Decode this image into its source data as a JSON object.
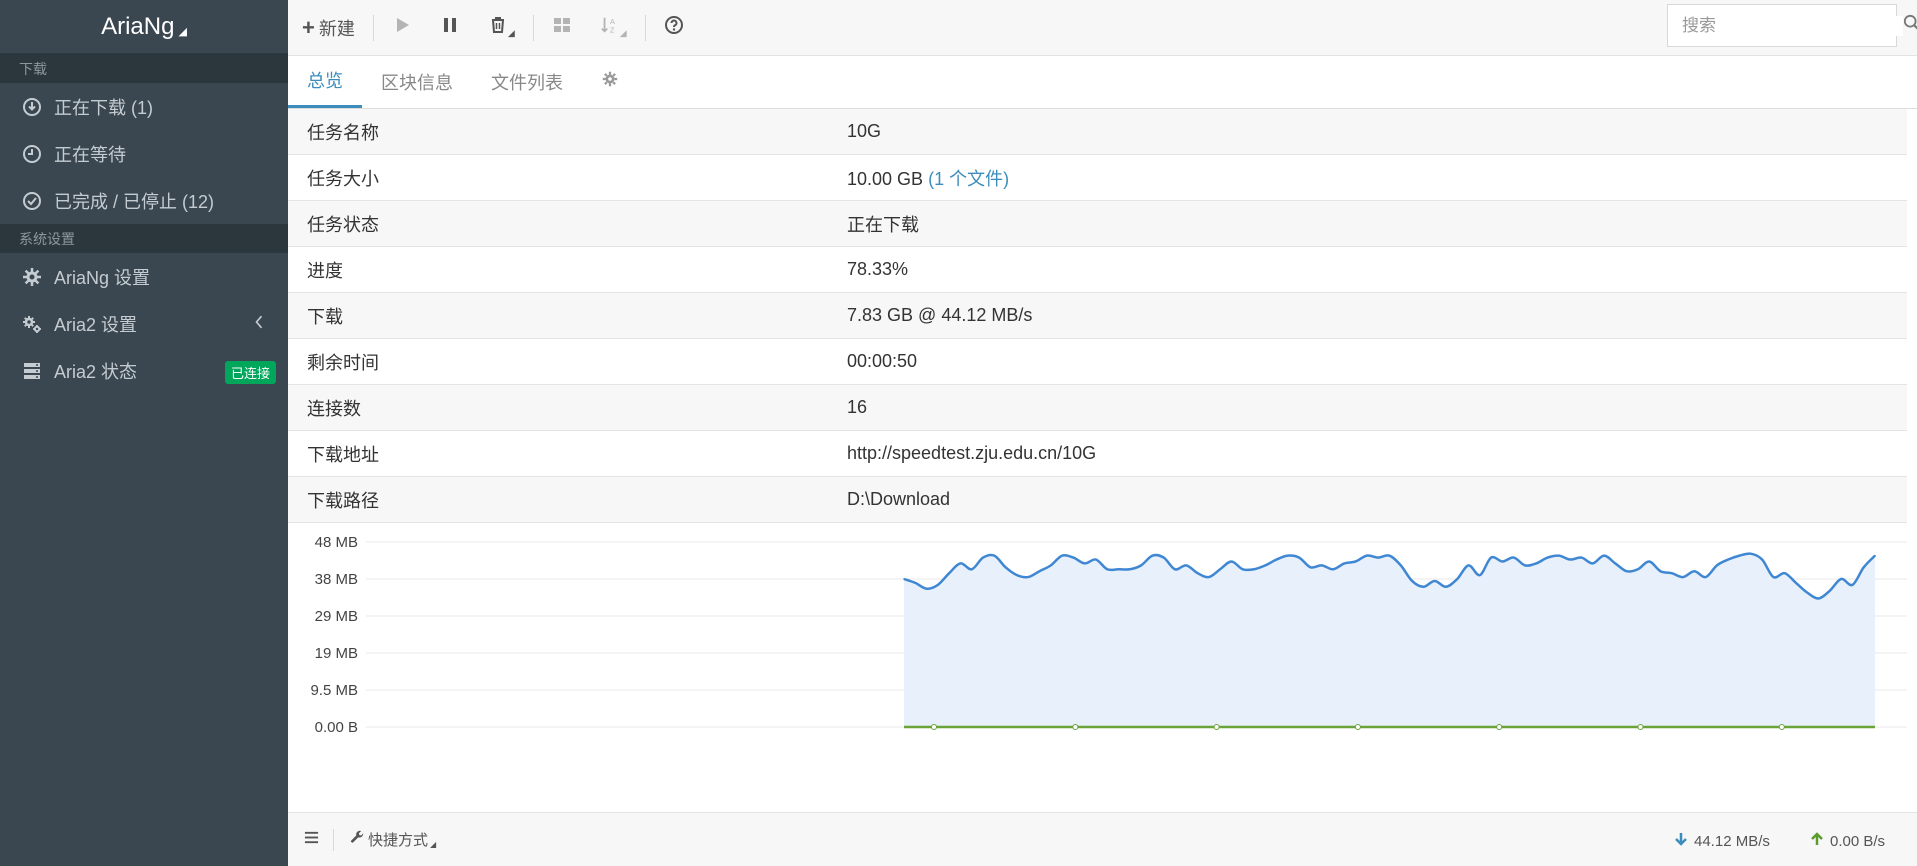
{
  "sidebar": {
    "brand": "AriaNg",
    "download_section": "下载",
    "items": [
      {
        "label": "正在下载 (1)"
      },
      {
        "label": "正在等待"
      },
      {
        "label": "已完成 / 已停止 (12)"
      }
    ],
    "settings_section": "系统设置",
    "settings_items": [
      {
        "label": "AriaNg 设置"
      },
      {
        "label": "Aria2 设置"
      },
      {
        "label": "Aria2 状态",
        "badge": "已连接"
      }
    ]
  },
  "toolbar": {
    "new_label": "新建",
    "search_placeholder": "搜索"
  },
  "tabs": [
    {
      "label": "总览",
      "active": true
    },
    {
      "label": "区块信息"
    },
    {
      "label": "文件列表"
    }
  ],
  "info": [
    {
      "key": "任务名称",
      "value": "10G"
    },
    {
      "key": "任务大小",
      "value": "10.00 GB",
      "link": "(1 个文件)"
    },
    {
      "key": "任务状态",
      "value": "正在下载"
    },
    {
      "key": "进度",
      "value": "78.33%"
    },
    {
      "key": "下载",
      "value": "7.83 GB @ 44.12 MB/s"
    },
    {
      "key": "剩余时间",
      "value": "00:00:50"
    },
    {
      "key": "连接数",
      "value": "16"
    },
    {
      "key": "下载地址",
      "value": "http://speedtest.zju.edu.cn/10G"
    },
    {
      "key": "下载路径",
      "value": "D:\\Download"
    }
  ],
  "chart_data": {
    "type": "area",
    "y_tick_labels": [
      "48 MB",
      "38 MB",
      "29 MB",
      "19 MB",
      "9.5 MB",
      "0.00 B"
    ],
    "ylim": [
      0,
      47.5
    ],
    "series": [
      {
        "values": [
          38,
          37,
          35.5,
          36.5,
          39.5,
          42,
          40.5,
          43.5,
          44,
          41,
          39,
          38.5,
          40,
          41.5,
          44,
          43.5,
          42,
          43,
          40.5,
          40.5,
          40.5,
          41.5,
          44,
          43.5,
          40.5,
          41.5,
          39.5,
          38.5,
          40.5,
          42.5,
          40.5,
          40.5,
          41.5,
          43,
          44,
          43.5,
          41,
          41.5,
          40.5,
          42,
          42.5,
          44,
          43.5,
          44,
          41.5,
          37.5,
          36,
          37.5,
          36,
          38,
          41.5,
          39,
          43.5,
          42.5,
          43.5,
          41.5,
          42,
          43.5,
          44,
          43,
          43.5,
          42,
          44,
          42,
          40,
          40.5,
          42.5,
          40,
          39.5,
          38.5,
          40,
          38.5,
          41.5,
          43,
          44,
          44.5,
          43,
          38.5,
          39.5,
          37,
          34.5,
          33,
          35,
          38,
          36.5,
          41,
          44
        ]
      },
      {
        "values": [
          0,
          0,
          0,
          0,
          0,
          0,
          0,
          0
        ]
      }
    ]
  },
  "footer": {
    "shortcut_label": "快捷方式",
    "download_speed": "44.12 MB/s",
    "upload_speed": "0.00 B/s"
  }
}
